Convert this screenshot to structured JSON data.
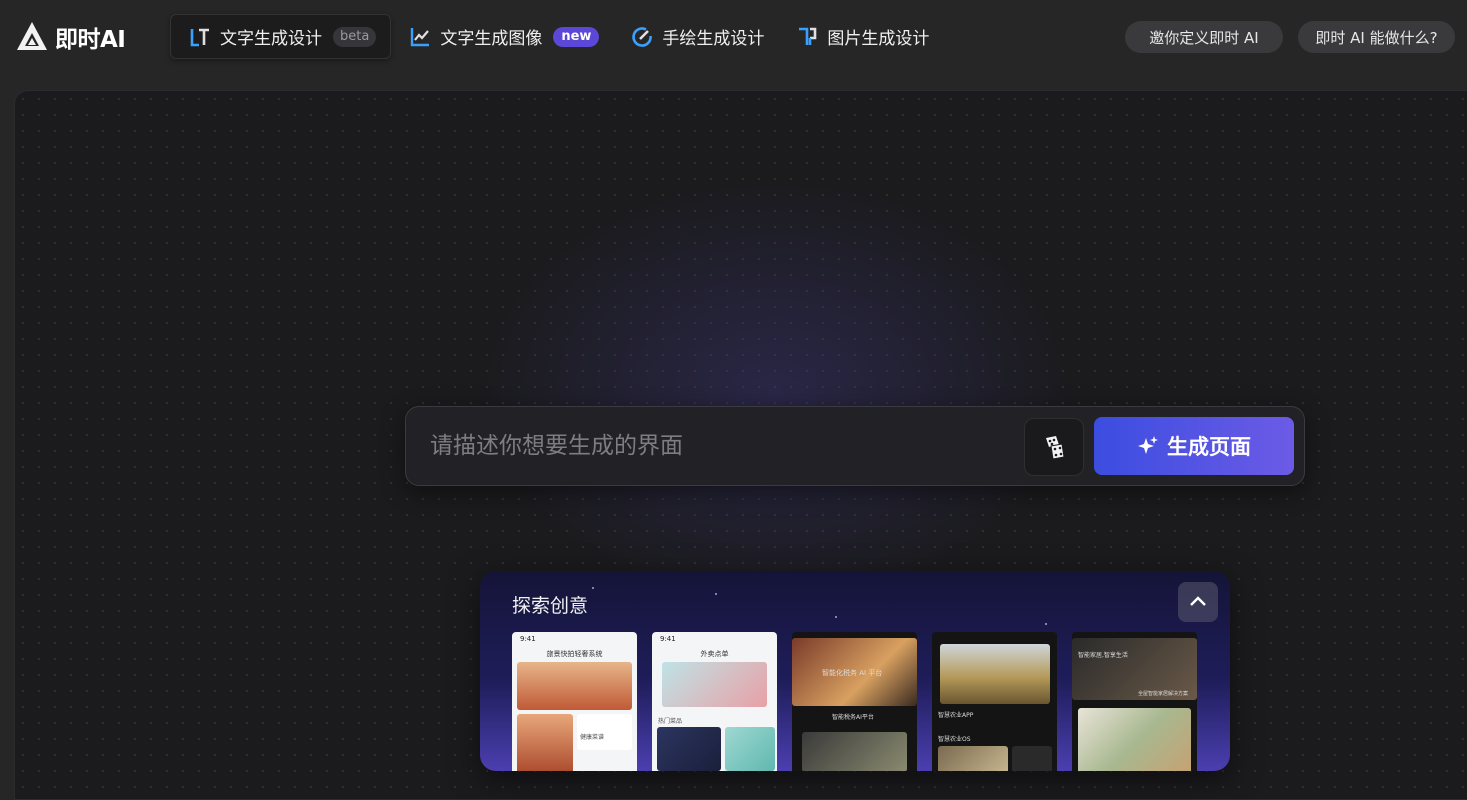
{
  "app": {
    "logo_text": "即时AI"
  },
  "nav": {
    "tabs": [
      {
        "label": "文字生成设计",
        "badge": "beta",
        "active": true
      },
      {
        "label": "文字生成图像",
        "badge": "new",
        "active": false
      },
      {
        "label": "手绘生成设计",
        "badge": "",
        "active": false
      },
      {
        "label": "图片生成设计",
        "badge": "",
        "active": false
      }
    ]
  },
  "header_actions": {
    "invite_label": "邀你定义即时 AI",
    "about_label": "即时 AI 能做什么?"
  },
  "prompt": {
    "placeholder": "请描述你想要生成的界面",
    "value": "",
    "generate_label": "生成页面"
  },
  "explore": {
    "title": "探索创意",
    "cards": [
      {
        "time": "9:41",
        "heading": "旅景快拍轻奢系统",
        "tag": "健康菜谱"
      },
      {
        "time": "9:41",
        "heading": "外卖点单",
        "tag": "热门菜品"
      },
      {
        "heading": "智能化税务 AI 平台",
        "caption": "智能税务AI平台"
      },
      {
        "heading": "智慧农业APP",
        "caption": "智慧农业OS"
      },
      {
        "heading": "智能家居,智享生活",
        "caption": "全屋智能家居解决方案"
      }
    ]
  },
  "colors": {
    "accent_start": "#3b4de0",
    "accent_end": "#6c5be6",
    "badge_new": "#5b48d8",
    "icon_blue": "#3aa0ff"
  },
  "icons": {
    "dice": "dice-icon",
    "sparkle": "sparkle-icon",
    "collapse": "chevron-up-icon"
  }
}
